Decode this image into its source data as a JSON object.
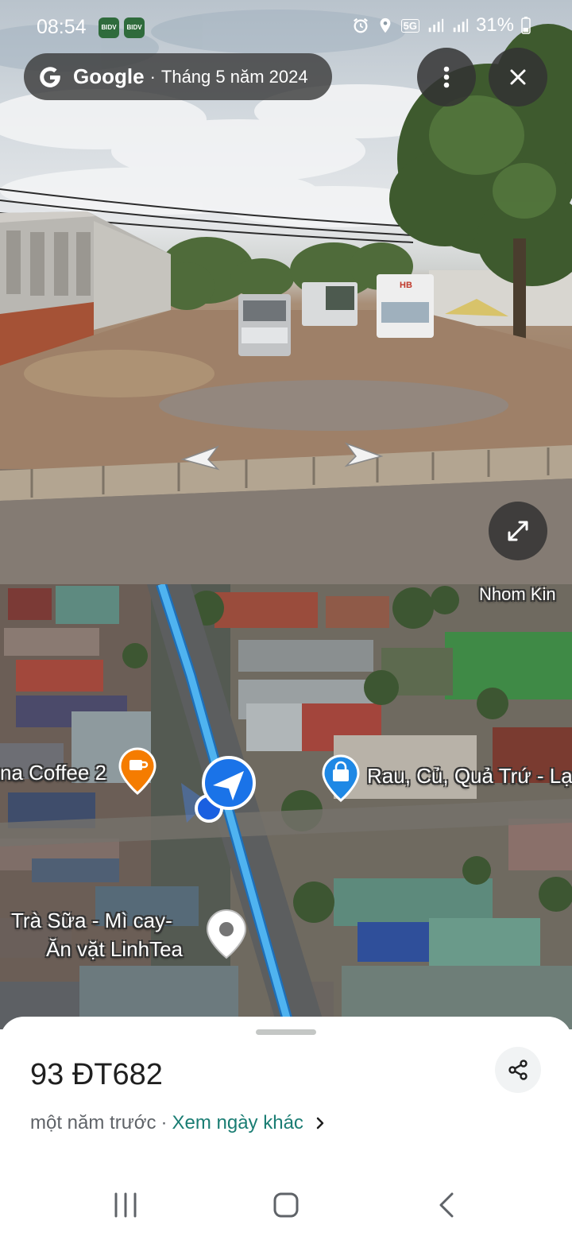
{
  "status_bar": {
    "time": "08:54",
    "app_icons": [
      "BIDV",
      "BIDV"
    ],
    "icons": [
      "alarm-icon",
      "location-icon",
      "5g-icon",
      "signal-icon",
      "signal-icon"
    ],
    "network": "5G",
    "battery": "31%"
  },
  "street_view": {
    "brand": "Google",
    "separator": "·",
    "date": "Tháng 5 năm 2024",
    "truck_sign": "HB"
  },
  "map": {
    "labels": {
      "top_right": "Nhom Kin",
      "coffee": "na Coffee 2",
      "store": "Rau, Củ, Quả Trứ - Lạ",
      "milk_tea_line1": "Trà Sữa - Mì cay-",
      "milk_tea_line2": "Ăn vặt LinhTea"
    },
    "route_color": "#4fb3f0",
    "coffee_pin_color": "#f57c00",
    "store_pin_color": "#1e88e5"
  },
  "sheet": {
    "address": "93 ĐT682",
    "time_ago": "một năm trước",
    "separator": "·",
    "other_dates_link": "Xem ngày khác",
    "link_color": "#1a7d73"
  },
  "navbar": {
    "buttons": [
      "recent-apps-icon",
      "home-icon",
      "back-icon"
    ]
  }
}
